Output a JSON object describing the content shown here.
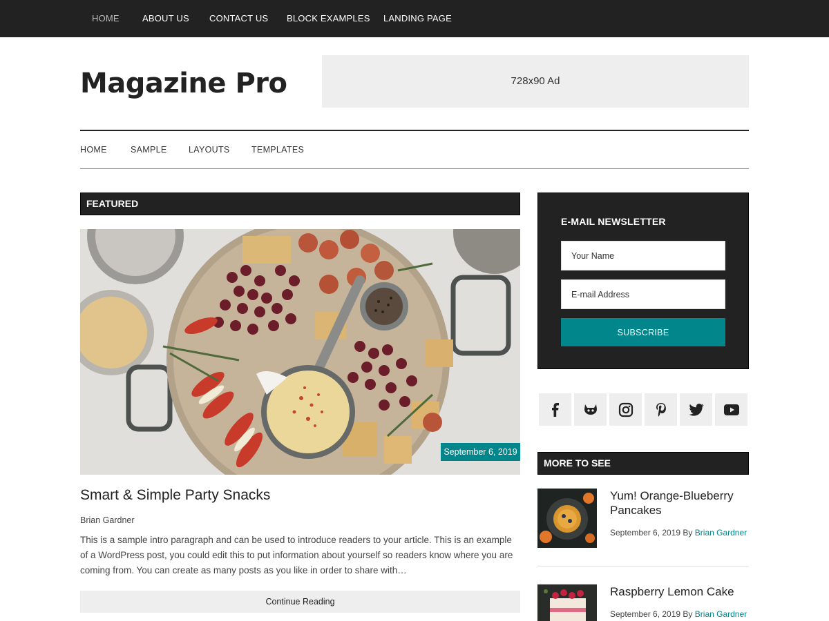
{
  "top_nav": {
    "items": [
      "HOME",
      "ABOUT US",
      "CONTACT US",
      "BLOCK EXAMPLES",
      "LANDING PAGE"
    ],
    "active_index": 0
  },
  "header": {
    "site_title": "Magazine Pro",
    "ad_label": "728x90 Ad"
  },
  "secondary_nav": {
    "items": [
      "HOME",
      "SAMPLE",
      "LAYOUTS",
      "TEMPLATES"
    ]
  },
  "featured": {
    "section_title": "FEATURED",
    "date": "September 6, 2019",
    "post_title": "Smart & Simple Party Snacks",
    "author": "Brian Gardner",
    "excerpt": "This is a sample intro paragraph and can be used to introduce readers to your article. This is an example of a WordPress post, you could edit this to put information about yourself so readers know where you are coming from. You can create as many posts as you like in order to share with…",
    "continue_label": "Continue Reading"
  },
  "newsletter": {
    "title": "E-MAIL NEWSLETTER",
    "name_placeholder": "Your Name",
    "email_placeholder": "E-mail Address",
    "subscribe_label": "SUBSCRIBE"
  },
  "social": {
    "icons": [
      "facebook-icon",
      "github-icon",
      "instagram-icon",
      "pinterest-icon",
      "twitter-icon",
      "youtube-icon"
    ]
  },
  "more_to_see": {
    "section_title": "MORE TO SEE",
    "posts": [
      {
        "title": "Yum! Orange-Blueberry Pancakes",
        "date": "September 6, 2019",
        "by": "By",
        "author": "Brian Gardner"
      },
      {
        "title": "Raspberry Lemon Cake",
        "date": "September 6, 2019",
        "by": "By",
        "author": "Brian Gardner"
      }
    ]
  },
  "colors": {
    "dark": "#222222",
    "accent": "#00868b",
    "light_gray": "#eeeeee"
  }
}
